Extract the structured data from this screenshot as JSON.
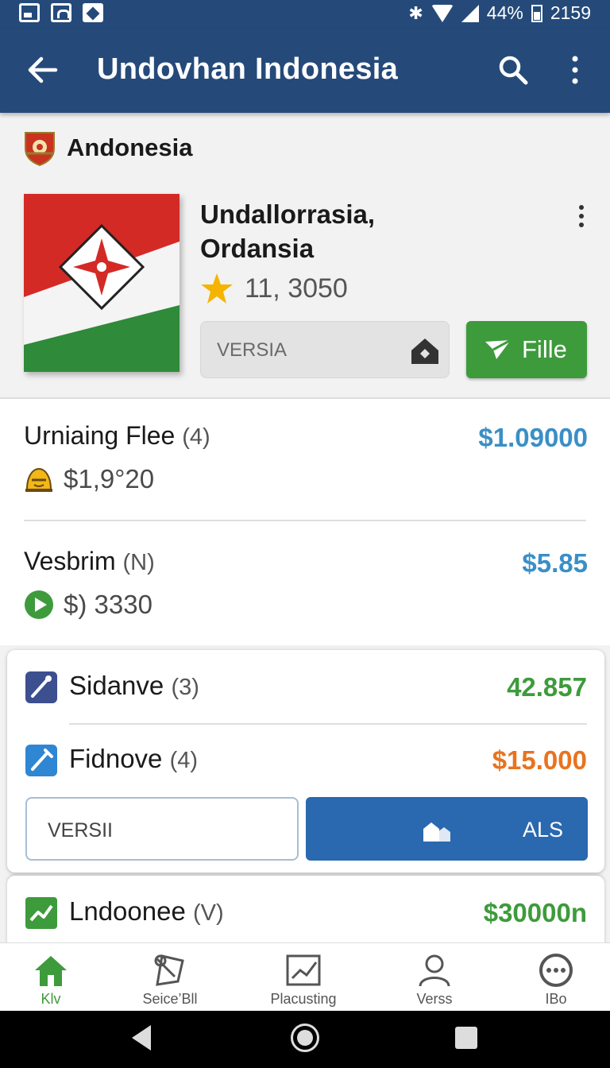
{
  "status": {
    "battery": "44%",
    "time": "2159"
  },
  "appbar": {
    "title": "Undovhan Indonesia",
    "back_icon": "arrow-left-icon",
    "search_icon": "search-icon",
    "menu_icon": "more-vert-icon"
  },
  "brand": {
    "name": "Andonesia",
    "logo_icon": "crest-logo"
  },
  "item": {
    "name_line1": "Undallorrasia,",
    "name_line2": "Ordansia",
    "rating": "11, 3050",
    "version_field": "VERSIA",
    "file_button": "Fille"
  },
  "list": [
    {
      "title": "Urniaing Flee",
      "count": "(4)",
      "price": "$1.09000",
      "sub": "$1,9°20"
    },
    {
      "title": "Vesbrim",
      "count": "(N)",
      "price": "$5.85",
      "sub": "$)  3330"
    }
  ],
  "card": {
    "rows": [
      {
        "label": "Sidanve",
        "count": "(3)",
        "value": "42.857",
        "color": "#3d9b3b"
      },
      {
        "label": "Fidnove",
        "count": "(4)",
        "value": "$15.000",
        "color": "#e8731f"
      }
    ],
    "input": "VERSII",
    "button": "ALS"
  },
  "card2": {
    "label": "Lndoonee",
    "count": "(V)",
    "value": "$30000n"
  },
  "nav": [
    {
      "label": "Klv",
      "icon": "home-icon"
    },
    {
      "label": "Seice’Bll",
      "icon": "tools-icon"
    },
    {
      "label": "Placusting",
      "icon": "chart-icon"
    },
    {
      "label": "Verss",
      "icon": "person-icon"
    },
    {
      "label": "IBo",
      "icon": "chat-dots-icon"
    }
  ],
  "colors": {
    "primary": "#254a7a",
    "green": "#3d9b3b",
    "blue_price": "#3a8fc7",
    "orange": "#e8731f",
    "button_blue": "#2a68b0"
  }
}
